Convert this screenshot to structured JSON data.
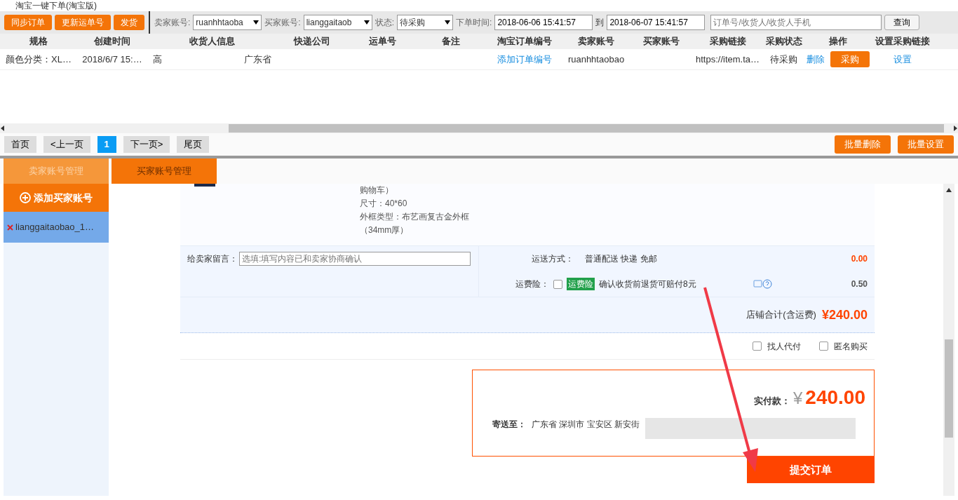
{
  "window": {
    "title": "淘宝一键下单(淘宝版)"
  },
  "toolbar": {
    "buttons": [
      "同步订单",
      "更新运单号",
      "发货"
    ],
    "filters": [
      {
        "label": "卖家账号:",
        "value": "ruanhhtaoba"
      },
      {
        "label": "买家账号:",
        "value": "lianggaitaob"
      },
      {
        "label": "状态:",
        "value": "待采购"
      }
    ],
    "date_label": "下单时间:",
    "date_from": "2018-06-06 15:41:57",
    "date_sep": "到",
    "date_to": "2018-06-07 15:41:57",
    "search": {
      "placeholder": "订单号/收货人/收货人手机"
    },
    "query_button": "查询"
  },
  "table": {
    "columns": [
      "规格",
      "创建时间",
      "收货人信息",
      "快递公司",
      "运单号",
      "备注",
      "淘宝订单编号",
      "卖家账号",
      "买家账号",
      "采购链接",
      "采购状态",
      "操作",
      "设置采购链接"
    ],
    "rows": [
      {
        "spec": "颜色分类：XL…",
        "created": "2018/6/7 15:…",
        "receiver": "高",
        "receiver_tail": "广东省",
        "taobao_order": "添加订单编号",
        "seller": "ruanhhtaobao",
        "link": "https://item.ta…",
        "status": "待采购",
        "delete": "删除",
        "buy": "采购",
        "setting": "设置"
      }
    ]
  },
  "pager": {
    "pages": [
      {
        "label": "首页",
        "selected": false
      },
      {
        "label": "<上一页",
        "selected": false
      },
      {
        "label": "1",
        "selected": true
      },
      {
        "label": "下一页>",
        "selected": false
      },
      {
        "label": "尾页",
        "selected": false
      }
    ],
    "actions": [
      "批量删除",
      "批量设置"
    ]
  },
  "tabs": [
    {
      "label": "卖家账号管理",
      "selected": false
    },
    {
      "label": "买家账号管理",
      "selected": true
    }
  ],
  "sidebar": {
    "add_button": "添加买家账号",
    "items": [
      {
        "name": "lianggaitaobao_1…",
        "selected": true
      }
    ]
  },
  "order": {
    "details": [
      "购物车）",
      "尺寸：40*60",
      "外框类型：布艺画复古金外框（34mm厚）"
    ],
    "message": {
      "label": "给卖家留言：",
      "placeholder": "选填:填写内容已和卖家协商确认"
    },
    "shipping": {
      "label": "运送方式：",
      "value": "普通配送 快递 免邮",
      "price": "0.00"
    },
    "insurance": {
      "label": "运费险：",
      "checked": false,
      "tag": "运费险",
      "text": "确认收货前退货可赔付8元",
      "price": "0.50"
    },
    "total": {
      "label": "店铺合计(含运费)",
      "value": "¥240.00"
    },
    "options": [
      {
        "label": "找人代付",
        "checked": false
      },
      {
        "label": "匿名购买",
        "checked": false
      }
    ],
    "summary": {
      "pay_label": "实付款：",
      "currency": "¥",
      "amount": "240.00",
      "ship_label": "寄送至：",
      "address": "广东省 深圳市 宝安区 新安街"
    },
    "submit": "提交订单"
  }
}
